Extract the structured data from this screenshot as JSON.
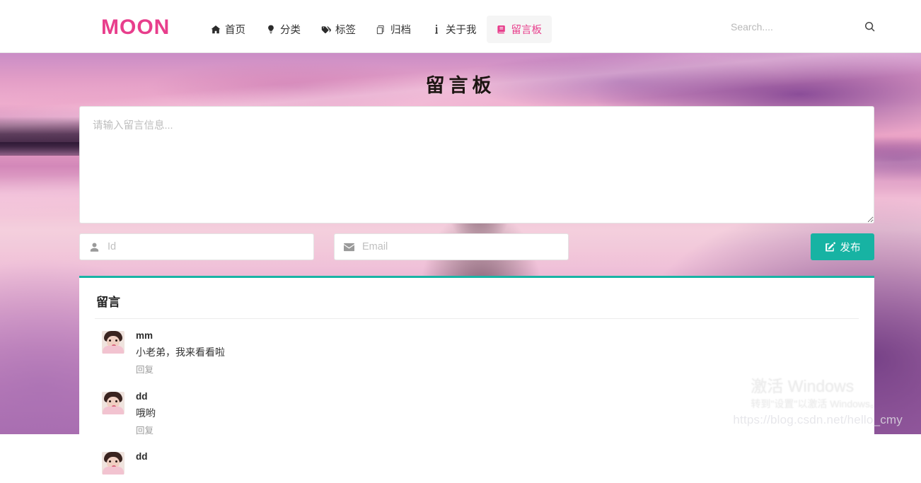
{
  "site": {
    "brand": "MOON",
    "accent_pink": "#e83e8c",
    "accent_teal": "#17b3a3"
  },
  "nav": {
    "items": [
      {
        "label": "首页",
        "icon": "home-icon",
        "active": false
      },
      {
        "label": "分类",
        "icon": "lightbulb-icon",
        "active": false
      },
      {
        "label": "标签",
        "icon": "tags-icon",
        "active": false
      },
      {
        "label": "归档",
        "icon": "copy-icon",
        "active": false
      },
      {
        "label": "关于我",
        "icon": "info-icon",
        "active": false
      },
      {
        "label": "留言板",
        "icon": "book-icon",
        "active": true
      }
    ]
  },
  "search": {
    "placeholder": "Search....",
    "value": "",
    "icon": "search-icon"
  },
  "hero": {
    "title": "留言板"
  },
  "form": {
    "message_placeholder": "请输入留言信息...",
    "message_value": "",
    "id_placeholder": "Id",
    "id_value": "",
    "id_icon": "user-icon",
    "email_placeholder": "Email",
    "email_value": "",
    "email_icon": "envelope-icon",
    "publish_label": "发布",
    "publish_icon": "edit-square-icon"
  },
  "comments": {
    "title": "留言",
    "reply_label": "回复",
    "items": [
      {
        "name": "mm",
        "text": "小老弟，我来看看啦",
        "reply": "回复"
      },
      {
        "name": "dd",
        "text": "哦哟",
        "reply": "回复"
      },
      {
        "name": "dd",
        "text": "",
        "reply": ""
      }
    ]
  },
  "watermark": {
    "windows_line1": "激活 Windows",
    "windows_line2": "转到\"设置\"以激活 Windows。",
    "csdn": "https://blog.csdn.net/hello_cmy"
  }
}
